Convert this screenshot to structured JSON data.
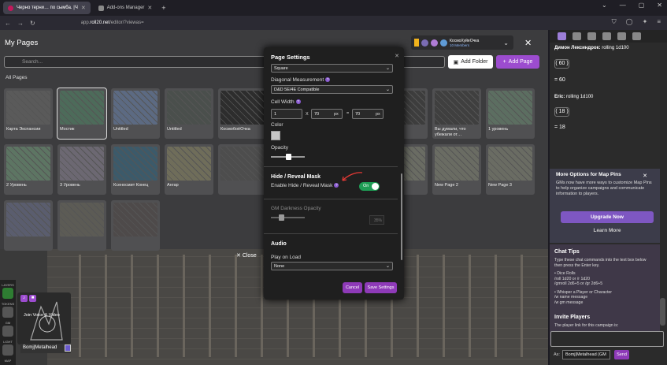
{
  "browser": {
    "tabs": [
      {
        "title": "Черно терни… по сымба. |Ч"
      },
      {
        "title": "Add-ons Manager"
      }
    ],
    "url_prefix": "app.",
    "url_domain": "roll20.net",
    "url_rest": "/editor/?viewas="
  },
  "pages_panel": {
    "title": "My Pages",
    "campaign_name": "КосмоХуйеОчка",
    "campaign_members": "10 Members",
    "search_placeholder": "Search...",
    "add_folder_label": "Add Folder",
    "add_page_label": "Add Page",
    "all_pages_label": "All Pages",
    "close_mode_label": "Close",
    "pages": [
      {
        "label": "Карта Экспансии",
        "color": "#5a5a5a"
      },
      {
        "label": "Мостик",
        "color": "#4d6b5a",
        "selected": true
      },
      {
        "label": "Untitled",
        "color": "#5c6a82"
      },
      {
        "label": "Untitled",
        "color": "#4a4f4c"
      },
      {
        "label": "КосмобоёОчка",
        "color": "#2d2d2d"
      },
      {
        "label": "",
        "color": "#3d3d3d"
      },
      {
        "label": "",
        "color": "#3d3d3d"
      },
      {
        "label": "",
        "color": "#3d3d3d"
      },
      {
        "label": "Вы думали, что убежали от…",
        "color": "#3f3f3f"
      },
      {
        "label": "1 уровень",
        "color": "#5c6e61"
      },
      {
        "label": "2 Уровень",
        "color": "#5d7563"
      },
      {
        "label": "3 Уровень",
        "color": "#6c6872"
      },
      {
        "label": "Ксеносмит Конец",
        "color": "#3c5a6a"
      },
      {
        "label": "Ангар",
        "color": "#6f6d5a"
      },
      {
        "label": "",
        "color": "#4d4d4d"
      },
      {
        "label": "",
        "color": "#4d4d4d"
      },
      {
        "label": "",
        "color": "#525252"
      },
      {
        "label": "",
        "color": "#6a6c63"
      },
      {
        "label": "New Page 2",
        "color": "#6a6c63"
      },
      {
        "label": "New Page 3",
        "color": "#6a6c63"
      },
      {
        "label": "",
        "color": "#5a5d6e"
      },
      {
        "label": "",
        "color": "#5c5b55"
      },
      {
        "label": "",
        "color": "#4e4a4a"
      }
    ]
  },
  "dialog": {
    "title": "Page Settings",
    "grid_type_value": "Square",
    "diag_label": "Diagonal Measurement",
    "diag_value": "D&D 5E/4E Compatible",
    "cell_width_label": "Cell Width",
    "cell_width_value": "1",
    "x_sep": "X",
    "px_value": "70",
    "px_unit": "px",
    "eq_sep": "=",
    "px_value2": "70",
    "px_unit2": "px",
    "color_label": "Color",
    "opacity_label": "Opacity",
    "hide_reveal_title": "Hide / Reveal Mask",
    "enable_mask_label": "Enable Hide / Reveal Mask",
    "toggle_label": "On",
    "gm_darkness_label": "GM Darkness Opacity",
    "gm_darkness_value": "35%",
    "audio_title": "Audio",
    "play_on_load_label": "Play on Load",
    "play_on_load_value": "None",
    "cancel_label": "Cancel",
    "save_label": "Save Settings"
  },
  "left": {
    "voice_label": "Join Voice & Video",
    "player_name": "Bomj|Metalhead",
    "tools": [
      "LAYERS",
      "TOKENS",
      "GM",
      "LIGHT",
      "MAP"
    ]
  },
  "chat": {
    "msg1_name": "Димон Лексиндрок:",
    "msg1_text": "rolling 1d100",
    "roll1": "( 60 )",
    "res1": "= 60",
    "msg2_name": "Eric:",
    "msg2_text": "rolling 1d100",
    "roll2": "( 18 )",
    "res2": "= 18",
    "promo_title": "More Options for Map Pins",
    "promo_desc": "GMs now have more ways to customize Map Pins to help organize campaigns and communicate information to players.",
    "upgrade_label": "Upgrade Now",
    "learn_label": "Learn More",
    "tips_title": "Chat Tips",
    "tips_intro": "Type these chat commands into the text box below then press the Enter key.",
    "tip1": "• Dice Rolls\n/roll 1d20 or /r 1d20\n/gmroll 2d6+5 or /gr 2d6+5",
    "tip2": "• Whisper a Player or Character\n/w name message\n/w gm message",
    "invite_title": "Invite Players",
    "invite_desc": "The player link for this campaign is:",
    "as_label": "As:",
    "as_value": "Bomj|Metalhead (GM",
    "send_label": "Send"
  }
}
